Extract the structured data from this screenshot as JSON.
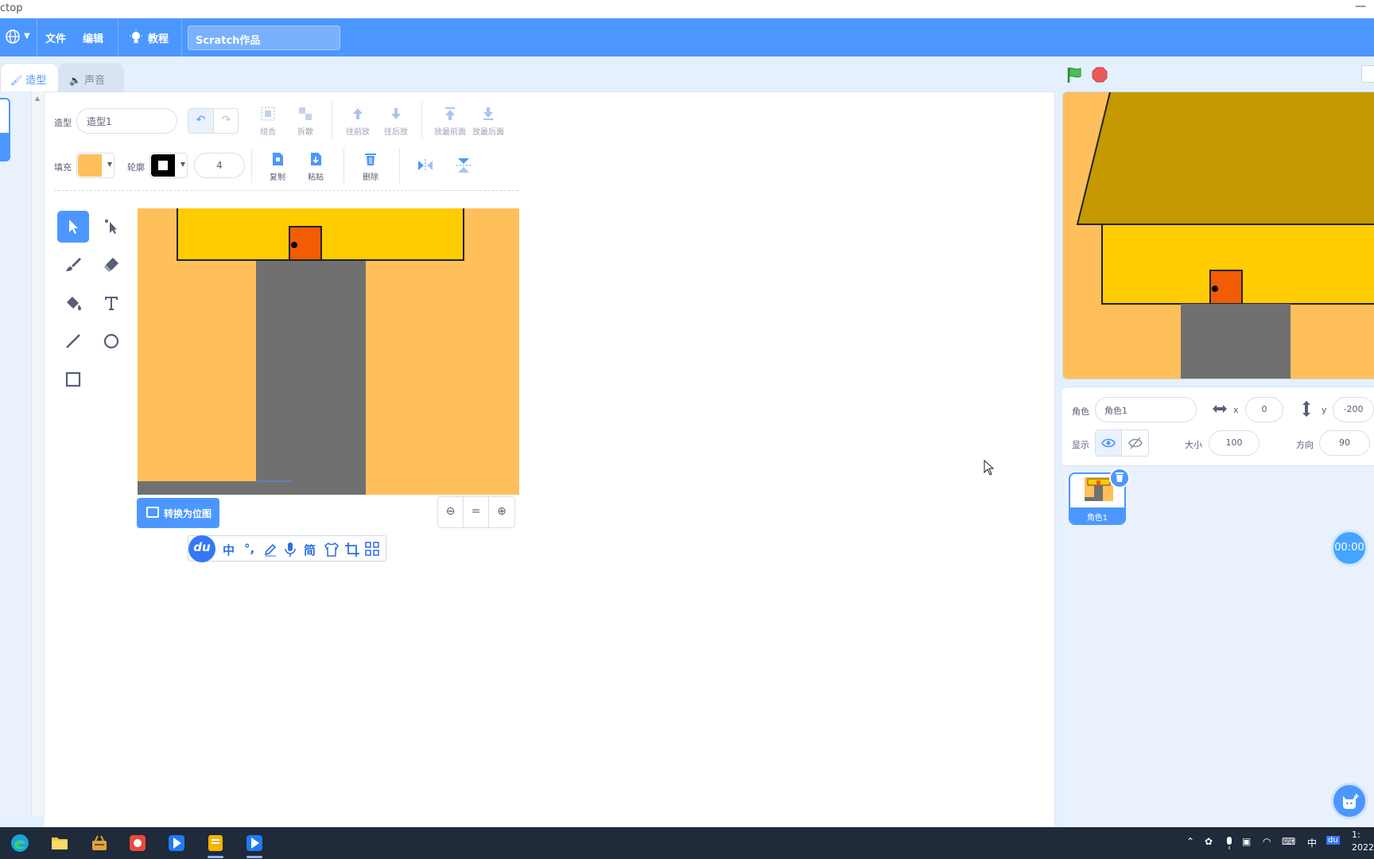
{
  "window": {
    "title": "ctop"
  },
  "menubar": {
    "file": "文件",
    "edit": "编辑",
    "tutorial": "教程",
    "project_name": "Scratch作品"
  },
  "tabs": {
    "costumes": "造型",
    "sounds": "声音"
  },
  "costume_editor": {
    "name_label": "造型",
    "name_value": "造型1",
    "group": "组合",
    "ungroup": "拆散",
    "forward": "往前放",
    "backward": "往后放",
    "front": "放最前面",
    "back": "放最后面",
    "fill_label": "填充",
    "outline_label": "轮廓",
    "outline_width": "4",
    "copy": "复制",
    "paste": "粘贴",
    "delete": "删除",
    "convert_bitmap": "转换为位图",
    "zoom_reset": "="
  },
  "ime_toolbar": {
    "logo": "du",
    "mode": "中",
    "punct": "°,",
    "simplified": "简"
  },
  "sprite_info": {
    "sprite_label": "角色",
    "sprite_name": "角色1",
    "x_label": "x",
    "x_value": "0",
    "y_label": "y",
    "y_value": "-200",
    "show_label": "显示",
    "size_label": "大小",
    "size_value": "100",
    "direction_label": "方向",
    "direction_value": "90"
  },
  "sprites": [
    {
      "name": "角色1"
    }
  ],
  "timer": "00:00",
  "taskbar": {
    "ime_mode": "中",
    "clock_time": "1:",
    "clock_date": "2022"
  },
  "colors": {
    "accent": "#4c97ff",
    "fill_swatch": "#ffbf5b",
    "outline_swatch": "#000000",
    "house_roof": "#c49a00",
    "house_wall": "#ffcc00",
    "door": "#f25c05",
    "road": "#707070"
  }
}
